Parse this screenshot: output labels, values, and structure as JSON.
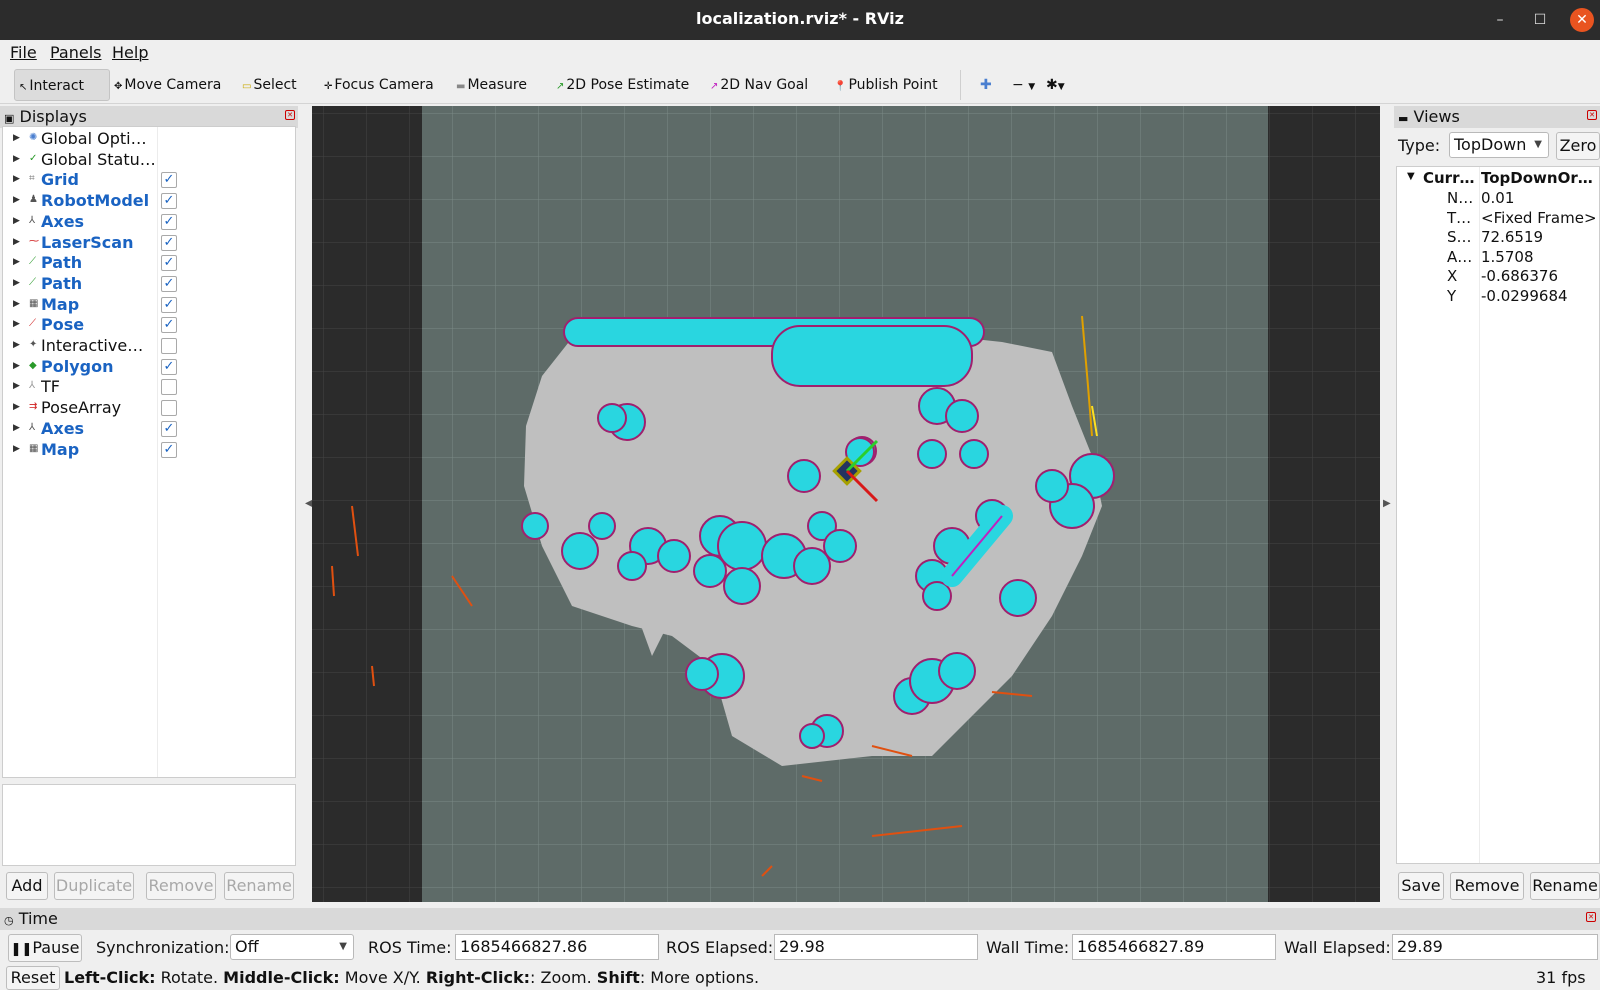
{
  "window": {
    "title": "localization.rviz* - RViz"
  },
  "menu": {
    "file": "File",
    "panels": "Panels",
    "help": "Help"
  },
  "toolbar": {
    "interact": "Interact",
    "move_camera": "Move Camera",
    "select": "Select",
    "focus_camera": "Focus Camera",
    "measure": "Measure",
    "pose_estimate": "2D Pose Estimate",
    "nav_goal": "2D Nav Goal",
    "publish_point": "Publish Point"
  },
  "displays": {
    "title": "Displays",
    "items": [
      {
        "label": "Global Opti…",
        "enabled": false,
        "has_check": false,
        "icon": "gear-icon",
        "color": "#4a7fd0"
      },
      {
        "label": "Global Statu…",
        "enabled": false,
        "has_check": false,
        "icon": "check-icon",
        "color": "#2a9a2a"
      },
      {
        "label": "Grid",
        "enabled": true,
        "has_check": true,
        "checked": true,
        "icon": "grid-icon",
        "color": "#777777"
      },
      {
        "label": "RobotModel",
        "enabled": true,
        "has_check": true,
        "checked": true,
        "icon": "robot-icon",
        "color": "#555555"
      },
      {
        "label": "Axes",
        "enabled": true,
        "has_check": true,
        "checked": true,
        "icon": "axes-icon",
        "color": "#555555"
      },
      {
        "label": "LaserScan",
        "enabled": true,
        "has_check": true,
        "checked": true,
        "icon": "laser-icon",
        "color": "#d02020"
      },
      {
        "label": "Path",
        "enabled": true,
        "has_check": true,
        "checked": true,
        "icon": "path-icon",
        "color": "#2a9a2a"
      },
      {
        "label": "Path",
        "enabled": true,
        "has_check": true,
        "checked": true,
        "icon": "path-icon",
        "color": "#2a9a2a"
      },
      {
        "label": "Map",
        "enabled": true,
        "has_check": true,
        "checked": true,
        "icon": "map-icon",
        "color": "#555555"
      },
      {
        "label": "Pose",
        "enabled": true,
        "has_check": true,
        "checked": true,
        "icon": "pose-icon",
        "color": "#d02020"
      },
      {
        "label": "Interactive…",
        "enabled": false,
        "has_check": true,
        "checked": false,
        "icon": "marker-icon",
        "color": "#555555"
      },
      {
        "label": "Polygon",
        "enabled": true,
        "has_check": true,
        "checked": true,
        "icon": "polygon-icon",
        "color": "#2a9a2a"
      },
      {
        "label": "TF",
        "enabled": false,
        "has_check": true,
        "checked": false,
        "icon": "tf-icon",
        "color": "#999999"
      },
      {
        "label": "PoseArray",
        "enabled": false,
        "has_check": true,
        "checked": false,
        "icon": "pose-array-icon",
        "color": "#d02020"
      },
      {
        "label": "Axes",
        "enabled": true,
        "has_check": true,
        "checked": true,
        "icon": "axes-icon",
        "color": "#555555"
      },
      {
        "label": "Map",
        "enabled": true,
        "has_check": true,
        "checked": true,
        "icon": "map-icon",
        "color": "#555555"
      }
    ],
    "buttons": {
      "add": "Add",
      "duplicate": "Duplicate",
      "remove": "Remove",
      "rename": "Rename"
    }
  },
  "views": {
    "title": "Views",
    "type_label": "Type:",
    "type_value": "TopDown",
    "zero": "Zero",
    "current_key": "Curr…",
    "current_value": "TopDownOr…",
    "props": [
      {
        "key": "N…",
        "value": "0.01"
      },
      {
        "key": "T…",
        "value": "<Fixed Frame>"
      },
      {
        "key": "S…",
        "value": "72.6519"
      },
      {
        "key": "A…",
        "value": "1.5708"
      },
      {
        "key": "X",
        "value": "-0.686376"
      },
      {
        "key": "Y",
        "value": "-0.0299684"
      }
    ],
    "buttons": {
      "save": "Save",
      "remove": "Remove",
      "rename": "Rename"
    }
  },
  "time": {
    "title": "Time",
    "pause": "Pause",
    "sync_label": "Synchronization:",
    "sync_value": "Off",
    "ros_time_label": "ROS Time:",
    "ros_time": "1685466827.86",
    "ros_elapsed_label": "ROS Elapsed:",
    "ros_elapsed": "29.98",
    "wall_time_label": "Wall Time:",
    "wall_time": "1685466827.89",
    "wall_elapsed_label": "Wall Elapsed:",
    "wall_elapsed": "29.89"
  },
  "status": {
    "reset": "Reset",
    "left_click_key": "Left-Click:",
    "left_click_val": " Rotate. ",
    "middle_click_key": "Middle-Click:",
    "middle_click_val": " Move X/Y. ",
    "right_click_key": "Right-Click:",
    "right_click_val": ": Zoom. ",
    "shift_key": "Shift",
    "shift_val": ": More options.",
    "fps": "31 fps"
  }
}
